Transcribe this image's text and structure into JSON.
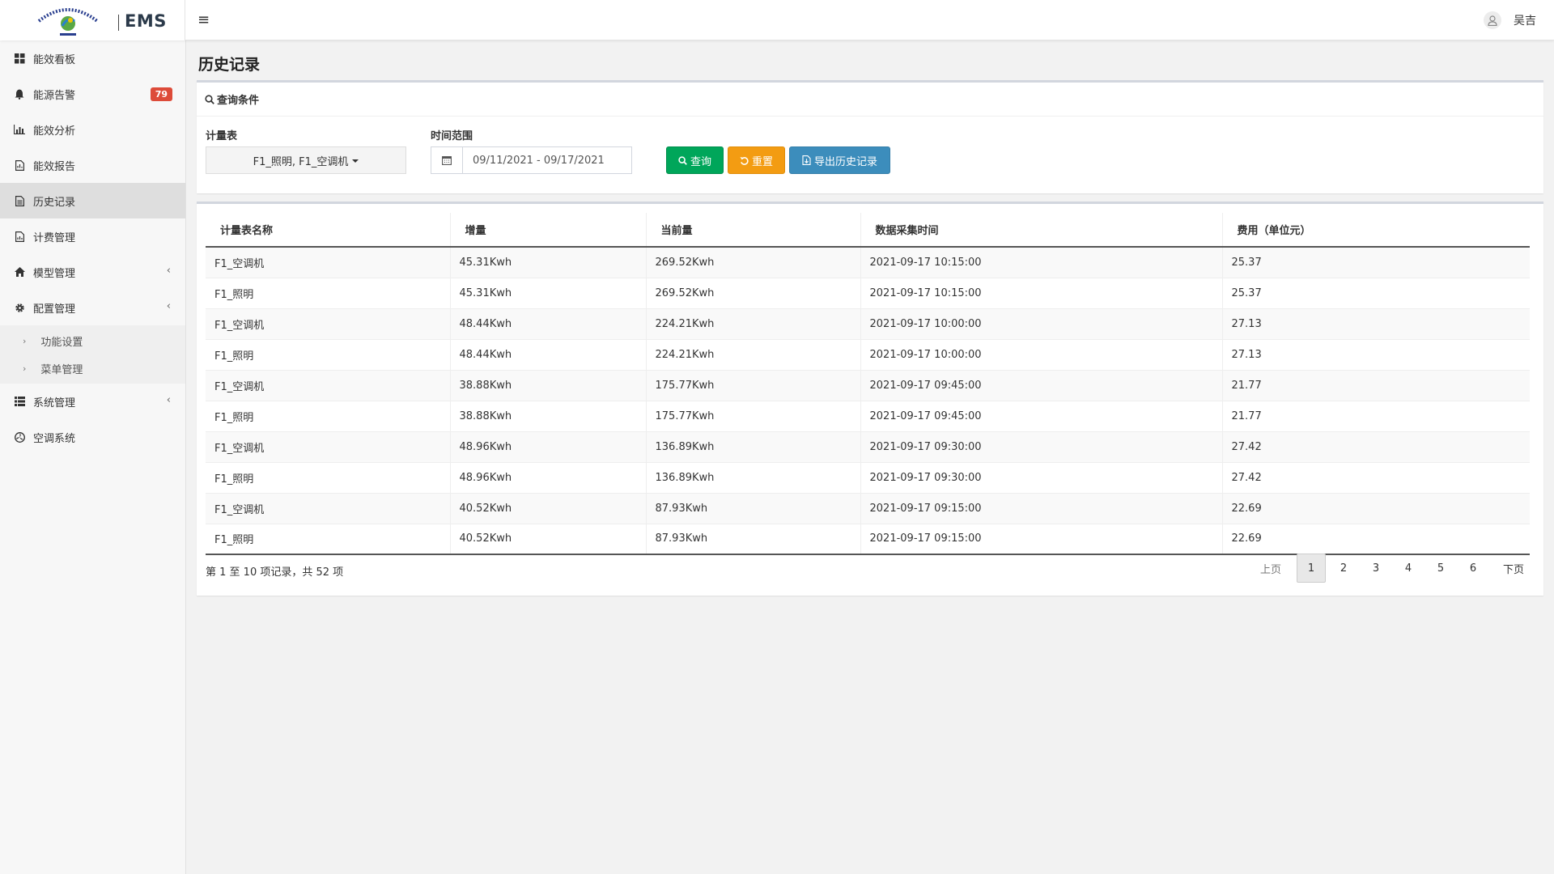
{
  "header": {
    "logo_text": "EMS",
    "menu_icon": "hamburger-icon",
    "user_name": "吴吉"
  },
  "sidebar": {
    "items": [
      {
        "label": "能效看板",
        "icon": "dashboard-icon"
      },
      {
        "label": "能源告警",
        "icon": "bell-icon",
        "badge": "79"
      },
      {
        "label": "能效分析",
        "icon": "bar-chart-icon"
      },
      {
        "label": "能效报告",
        "icon": "report-icon"
      },
      {
        "label": "历史记录",
        "icon": "document-icon"
      },
      {
        "label": "计费管理",
        "icon": "billing-icon"
      },
      {
        "label": "模型管理",
        "icon": "home-icon"
      },
      {
        "label": "配置管理",
        "icon": "gear-icon"
      },
      {
        "label": "系统管理",
        "icon": "list-icon"
      },
      {
        "label": "空调系统",
        "icon": "aircon-icon"
      }
    ],
    "submenu": [
      {
        "label": "功能设置"
      },
      {
        "label": "菜单管理"
      }
    ]
  },
  "page": {
    "title": "历史记录"
  },
  "query": {
    "header": "查询条件",
    "meter_label": "计量表",
    "meter_value": "F1_照明, F1_空调机",
    "time_label": "时间范围",
    "date_range": "09/11/2021 - 09/17/2021",
    "btn_query": "查询",
    "btn_reset": "重置",
    "btn_export": "导出历史记录"
  },
  "table": {
    "columns": [
      "计量表名称",
      "增量",
      "当前量",
      "数据采集时间",
      "费用（单位元）"
    ],
    "rows": [
      [
        "F1_空调机",
        "45.31Kwh",
        "269.52Kwh",
        "2021-09-17 10:15:00",
        "25.37"
      ],
      [
        "F1_照明",
        "45.31Kwh",
        "269.52Kwh",
        "2021-09-17 10:15:00",
        "25.37"
      ],
      [
        "F1_空调机",
        "48.44Kwh",
        "224.21Kwh",
        "2021-09-17 10:00:00",
        "27.13"
      ],
      [
        "F1_照明",
        "48.44Kwh",
        "224.21Kwh",
        "2021-09-17 10:00:00",
        "27.13"
      ],
      [
        "F1_空调机",
        "38.88Kwh",
        "175.77Kwh",
        "2021-09-17 09:45:00",
        "21.77"
      ],
      [
        "F1_照明",
        "38.88Kwh",
        "175.77Kwh",
        "2021-09-17 09:45:00",
        "21.77"
      ],
      [
        "F1_空调机",
        "48.96Kwh",
        "136.89Kwh",
        "2021-09-17 09:30:00",
        "27.42"
      ],
      [
        "F1_照明",
        "48.96Kwh",
        "136.89Kwh",
        "2021-09-17 09:30:00",
        "27.42"
      ],
      [
        "F1_空调机",
        "40.52Kwh",
        "87.93Kwh",
        "2021-09-17 09:15:00",
        "22.69"
      ],
      [
        "F1_照明",
        "40.52Kwh",
        "87.93Kwh",
        "2021-09-17 09:15:00",
        "22.69"
      ]
    ],
    "info": "第 1 至 10 项记录，共 52 项"
  },
  "pagination": {
    "prev": "上页",
    "pages": [
      "1",
      "2",
      "3",
      "4",
      "5",
      "6"
    ],
    "next": "下页",
    "current": "1"
  },
  "colors": {
    "query_btn": "#00a65a",
    "reset_btn": "#f39c12",
    "export_btn": "#3c8dbc",
    "badge": "#dd4b39"
  }
}
